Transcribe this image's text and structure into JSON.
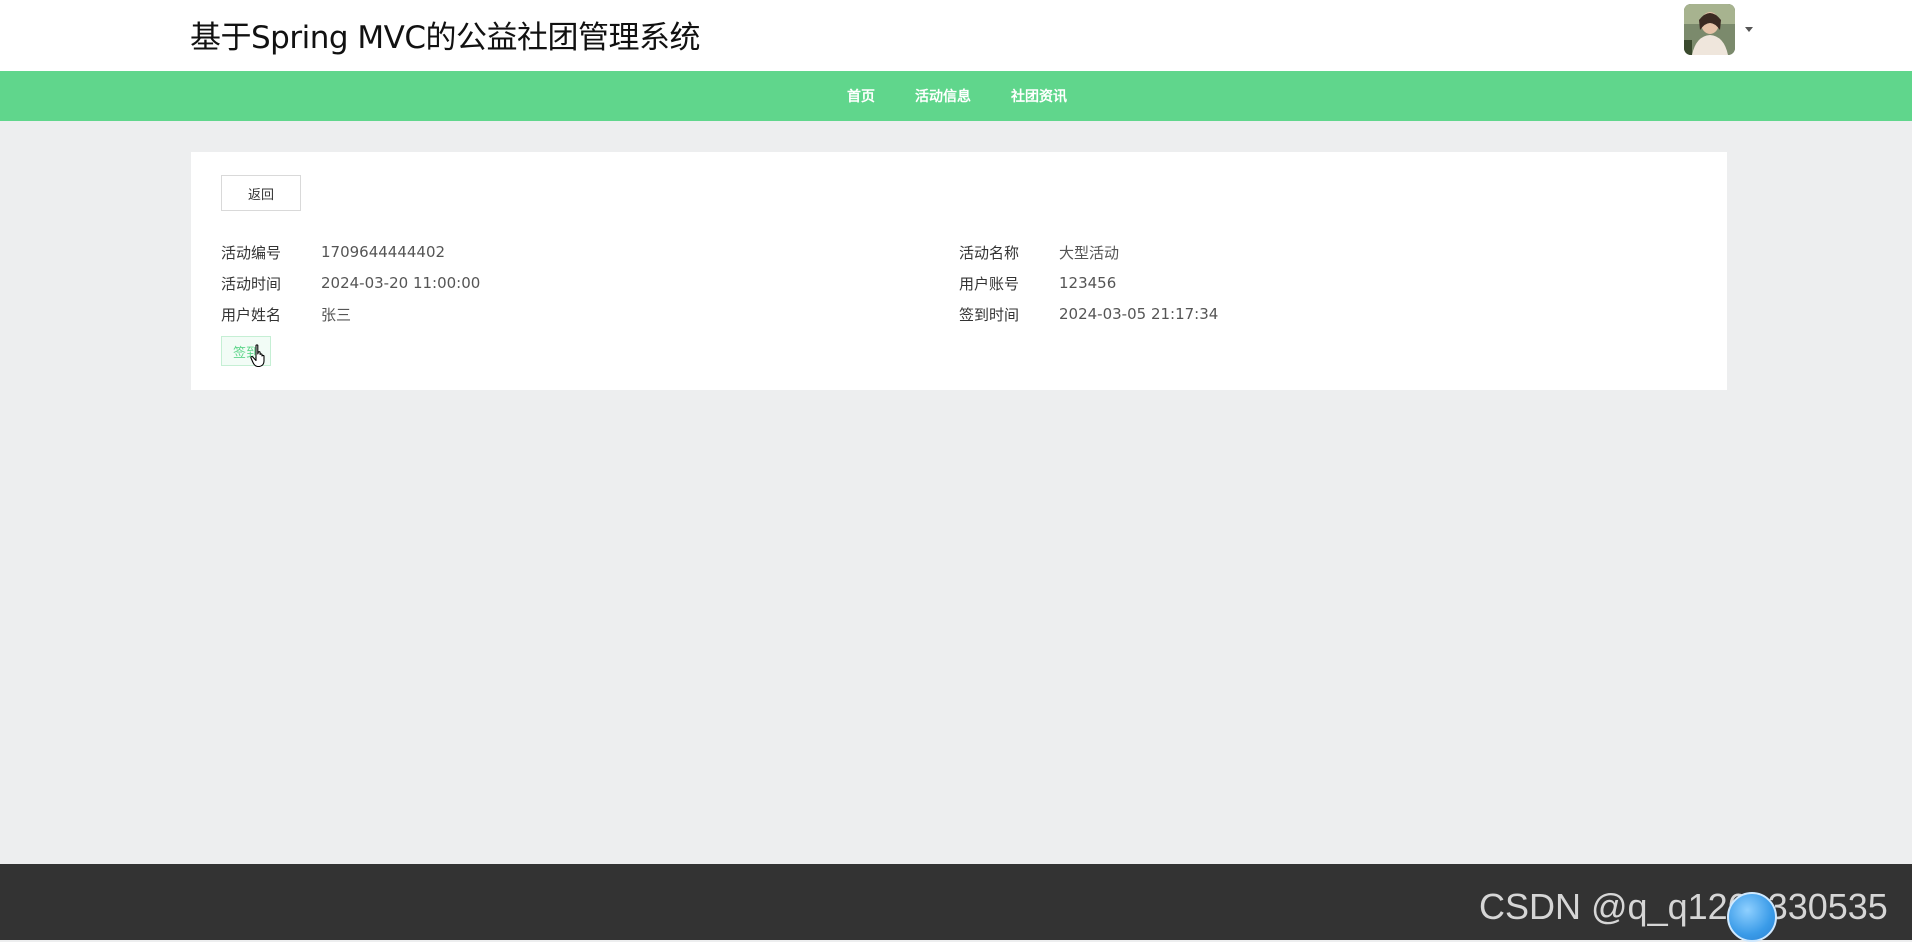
{
  "header": {
    "title": "基于Spring MVC的公益社团管理系统",
    "avatar_icon": "user-avatar-photo"
  },
  "nav": {
    "items": [
      {
        "label": "首页"
      },
      {
        "label": "活动信息"
      },
      {
        "label": "社团资讯"
      }
    ]
  },
  "detail": {
    "back_label": "返回",
    "fields": {
      "activity_no": {
        "label": "活动编号",
        "value": "1709644444402"
      },
      "activity_name": {
        "label": "活动名称",
        "value": "大型活动"
      },
      "activity_time": {
        "label": "活动时间",
        "value": "2024-03-20 11:00:00"
      },
      "user_account": {
        "label": "用户账号",
        "value": "123456"
      },
      "user_name": {
        "label": "用户姓名",
        "value": "张三"
      },
      "sign_time": {
        "label": "签到时间",
        "value": "2024-03-05 21:17:34"
      }
    },
    "sign_label": "签到"
  },
  "footer": {
    "watermark": "CSDN @q_q1262330535"
  },
  "colors": {
    "accent": "#60d68c",
    "footer_bg": "#333333",
    "page_bg": "#edeeef"
  }
}
